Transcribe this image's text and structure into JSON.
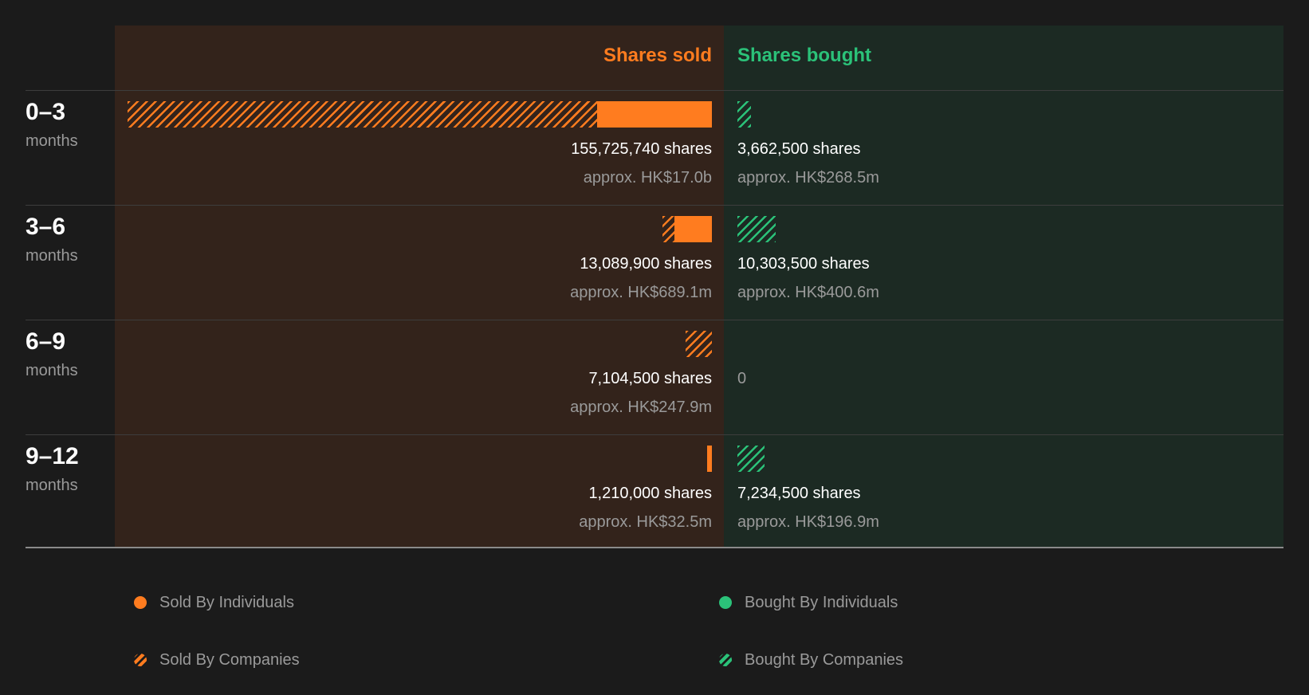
{
  "chart_data": {
    "type": "bar",
    "headers": {
      "sold": "Shares sold",
      "bought": "Shares bought"
    },
    "colors": {
      "sold": "#ff7c1f",
      "bought": "#2bc279"
    },
    "categories": [
      "0–3",
      "3–6",
      "6–9",
      "9–12"
    ],
    "unit_label": "months",
    "rows": [
      {
        "period": "0–3",
        "unit": "months",
        "sold": {
          "individuals": 30500000,
          "companies": 125225740,
          "shares_text": "155,725,740 shares",
          "approx_text": "approx. HK$17.0b"
        },
        "bought": {
          "individuals": 0,
          "companies": 3662500,
          "shares_text": "3,662,500 shares",
          "approx_text": "approx. HK$268.5m"
        }
      },
      {
        "period": "3–6",
        "unit": "months",
        "sold": {
          "individuals": 10000000,
          "companies": 3089900,
          "shares_text": "13,089,900 shares",
          "approx_text": "approx. HK$689.1m"
        },
        "bought": {
          "individuals": 0,
          "companies": 10303500,
          "shares_text": "10,303,500 shares",
          "approx_text": "approx. HK$400.6m"
        }
      },
      {
        "period": "6–9",
        "unit": "months",
        "sold": {
          "individuals": 0,
          "companies": 7104500,
          "shares_text": "7,104,500 shares",
          "approx_text": "approx. HK$247.9m"
        },
        "bought": {
          "individuals": 0,
          "companies": 0,
          "shares_text": "0",
          "approx_text": ""
        }
      },
      {
        "period": "9–12",
        "unit": "months",
        "sold": {
          "individuals": 1210000,
          "companies": 0,
          "shares_text": "1,210,000 shares",
          "approx_text": "approx. HK$32.5m"
        },
        "bought": {
          "individuals": 0,
          "companies": 7234500,
          "shares_text": "7,234,500 shares",
          "approx_text": "approx. HK$196.9m"
        }
      }
    ],
    "legend": [
      {
        "label": "Sold By Individuals",
        "style": "solid",
        "side": "sold"
      },
      {
        "label": "Bought By Individuals",
        "style": "solid",
        "side": "bought"
      },
      {
        "label": "Sold By Companies",
        "style": "hatched",
        "side": "sold"
      },
      {
        "label": "Bought By Companies",
        "style": "hatched",
        "side": "bought"
      }
    ]
  }
}
